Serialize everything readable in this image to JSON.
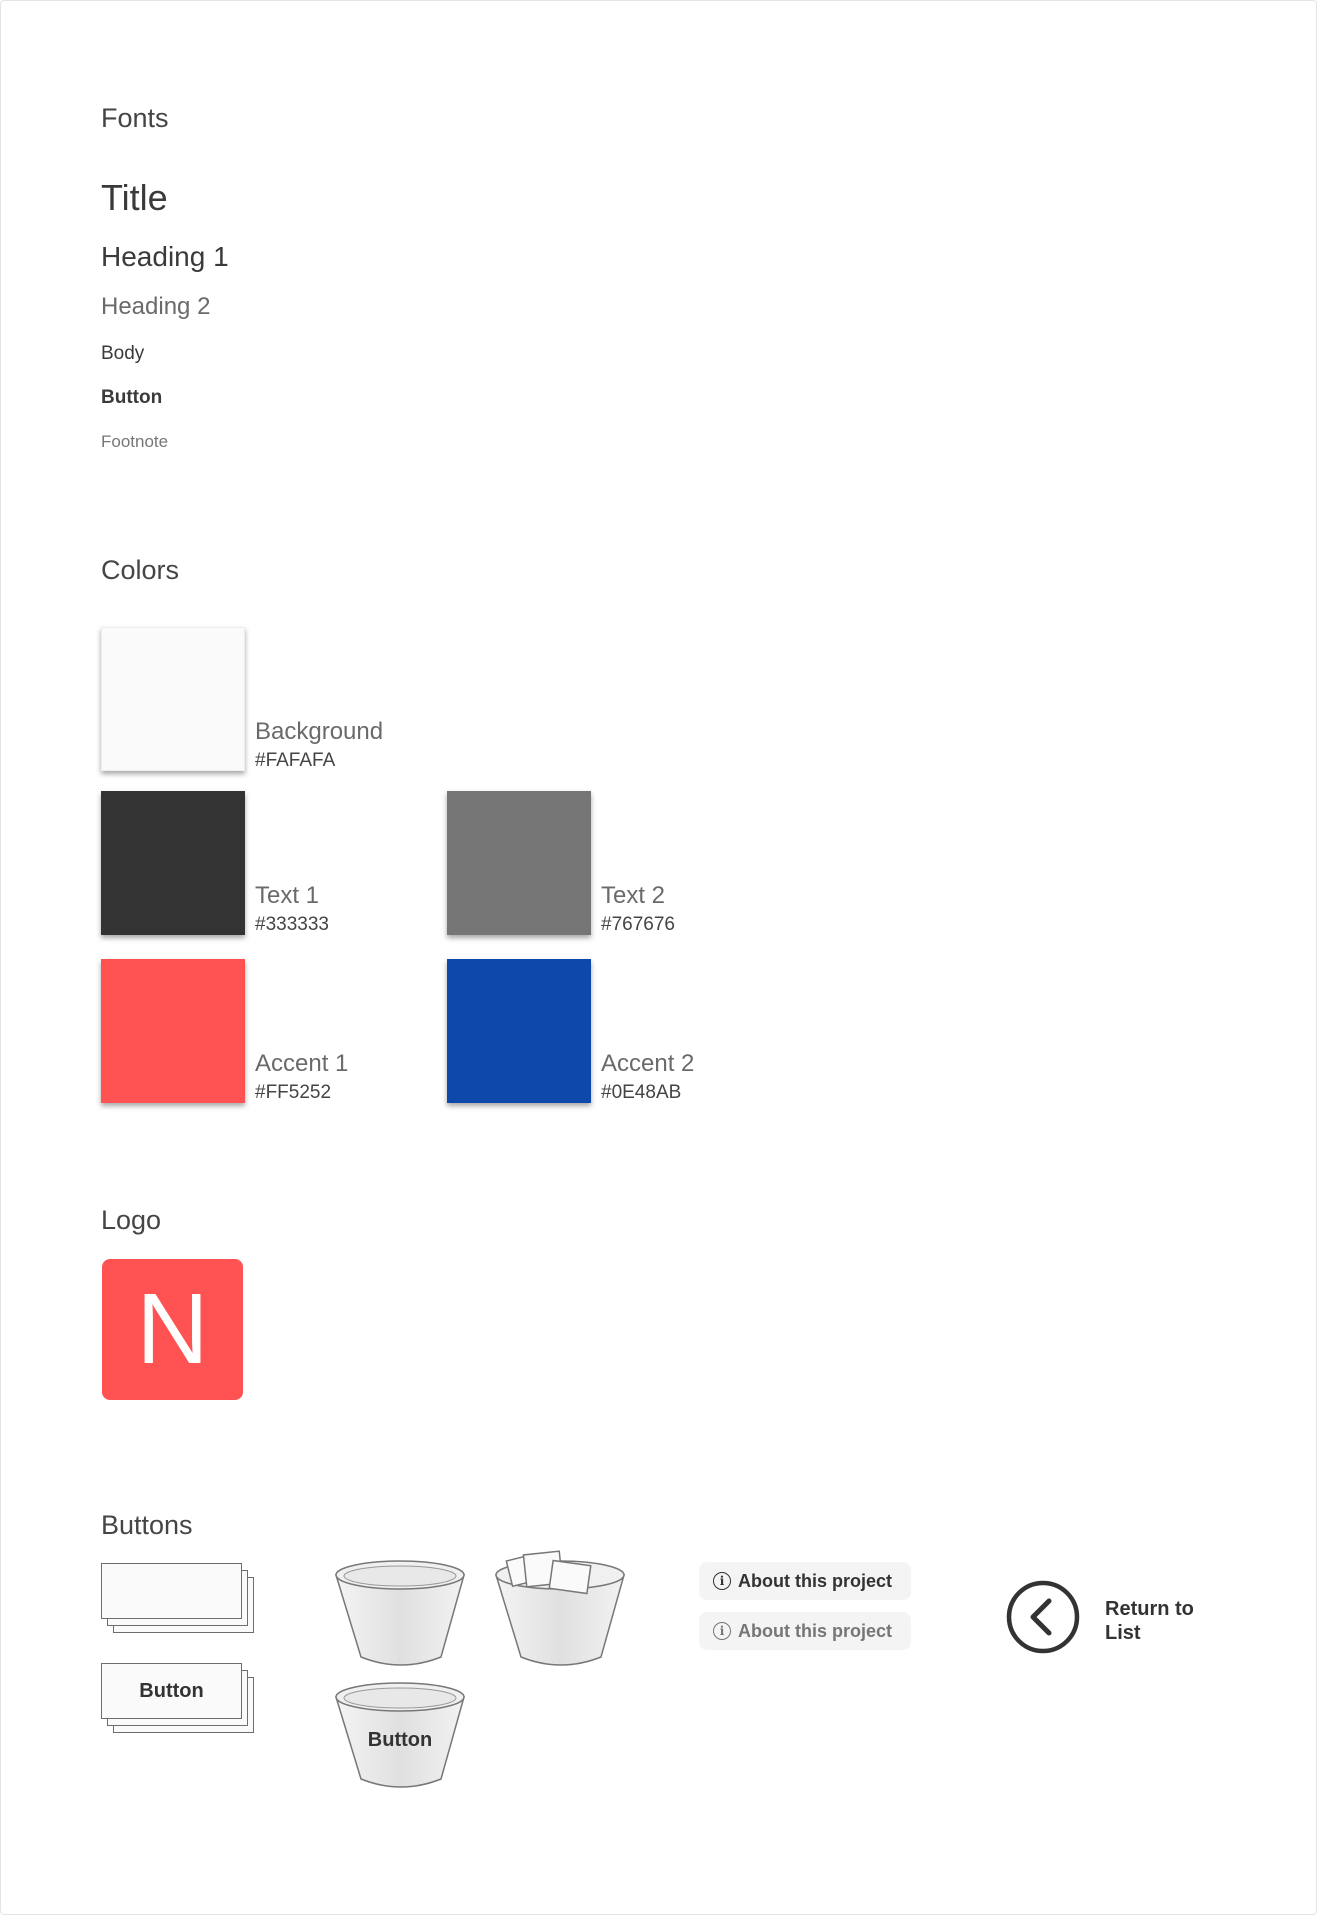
{
  "sections": {
    "fonts": "Fonts",
    "colors": "Colors",
    "logo": "Logo",
    "buttons": "Buttons"
  },
  "fonts": {
    "title": "Title",
    "heading1": "Heading 1",
    "heading2": "Heading 2",
    "body": "Body",
    "button": "Button",
    "footnote": "Footnote"
  },
  "colors": [
    {
      "name": "Background",
      "hex": "#FAFAFA"
    },
    {
      "name": "Text 1",
      "hex": "#333333"
    },
    {
      "name": "Text 2",
      "hex": "#767676"
    },
    {
      "name": "Accent 1",
      "hex": "#FF5252"
    },
    {
      "name": "Accent 2",
      "hex": "#0E48AB"
    }
  ],
  "logo": {
    "letter": "N",
    "color": "#FF5252"
  },
  "buttons": {
    "stack_button_label": "Button",
    "bucket_button_label": "Button",
    "about_label_active": "About this project",
    "about_label_inactive": "About this project",
    "info_icon_glyph": "i",
    "return_label_line1": "Return to",
    "return_label_line2": "List"
  },
  "icons": [
    "info-icon",
    "back-arrow-icon",
    "bucket-icon",
    "bucket-full-icon"
  ]
}
